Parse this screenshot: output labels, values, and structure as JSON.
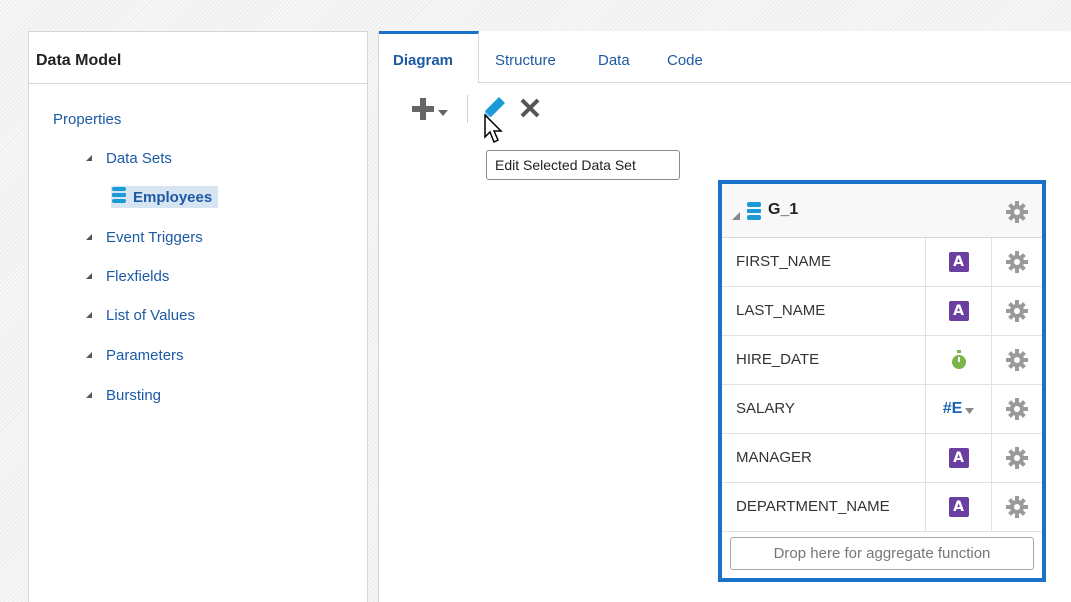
{
  "left_panel": {
    "title": "Data Model",
    "properties": "Properties",
    "items": [
      {
        "label": "Data Sets"
      },
      {
        "label": "Employees"
      },
      {
        "label": "Event Triggers"
      },
      {
        "label": "Flexfields"
      },
      {
        "label": "List of Values"
      },
      {
        "label": "Parameters"
      },
      {
        "label": "Bursting"
      }
    ]
  },
  "tabs": [
    {
      "label": "Diagram",
      "active": true
    },
    {
      "label": "Structure"
    },
    {
      "label": "Data"
    },
    {
      "label": "Code"
    }
  ],
  "toolbar": {
    "add_icon": "plus-dropdown-icon",
    "edit_icon": "pencil-icon",
    "delete_icon": "x-icon"
  },
  "tooltip": "Edit Selected Data Set",
  "group": {
    "title": "G_1",
    "columns": [
      {
        "name": "FIRST_NAME",
        "type": "A",
        "type_icon": "string-type-icon"
      },
      {
        "name": "LAST_NAME",
        "type": "A",
        "type_icon": "string-type-icon"
      },
      {
        "name": "HIRE_DATE",
        "type": "",
        "type_icon": "date-type-icon"
      },
      {
        "name": "SALARY",
        "type": "#E",
        "type_icon": "number-type-icon"
      },
      {
        "name": "MANAGER",
        "type": "A",
        "type_icon": "string-type-icon"
      },
      {
        "name": "DEPARTMENT_NAME",
        "type": "A",
        "type_icon": "string-type-icon"
      }
    ],
    "aggregate_drop": "Drop here for aggregate function"
  },
  "colors": {
    "accent": "#1a72c8",
    "link": "#1d5aa4",
    "string_type": "#6b3fa0",
    "date_type": "#7ab648"
  }
}
